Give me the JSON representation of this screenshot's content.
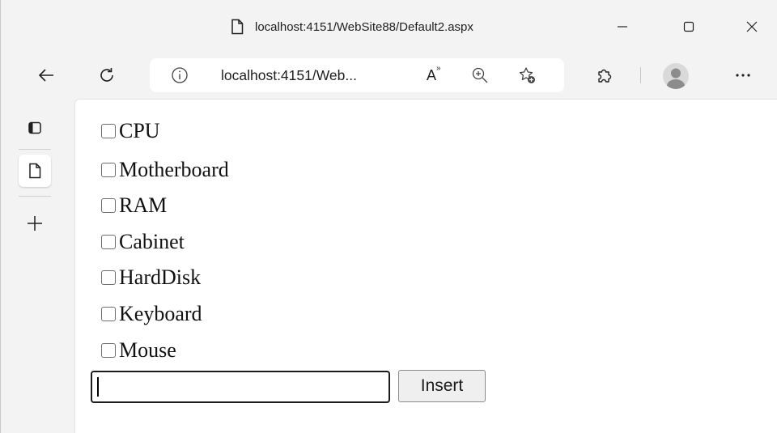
{
  "browser": {
    "tab_title": "localhost:4151/WebSite88/Default2.aspx",
    "address_url": "localhost:4151/Web...",
    "read_aloud_glyph": "A"
  },
  "page": {
    "checkboxes": [
      {
        "label": "CPU",
        "checked": false
      },
      {
        "label": "Motherboard",
        "checked": false
      },
      {
        "label": "RAM",
        "checked": false
      },
      {
        "label": "Cabinet",
        "checked": false
      },
      {
        "label": "HardDisk",
        "checked": false
      },
      {
        "label": "Keyboard",
        "checked": false
      },
      {
        "label": "Mouse",
        "checked": false
      }
    ],
    "input_value": "",
    "insert_label": "Insert"
  }
}
